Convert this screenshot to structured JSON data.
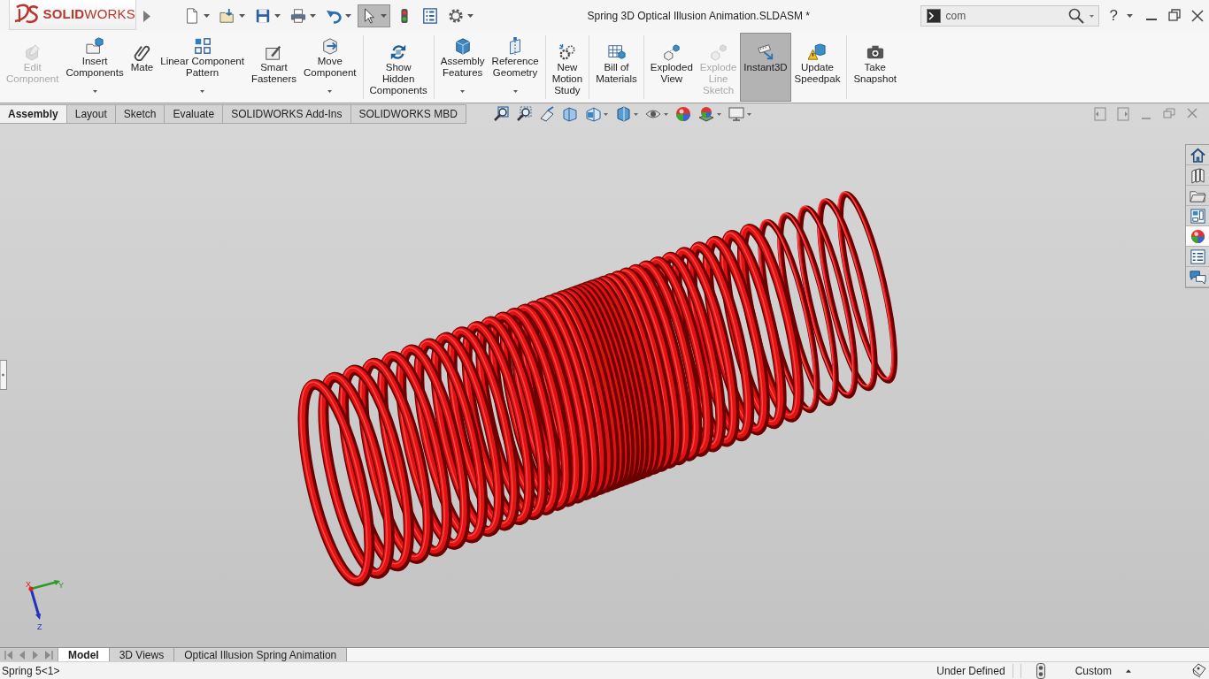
{
  "title_bar": {
    "logo": "**SOLID**WORKS",
    "quick_access": [
      {
        "selected": false,
        "dropdown": true
      },
      {
        "selected": false,
        "dropdown": true
      },
      {
        "selected": false,
        "dropdown": true
      },
      {
        "selected": false,
        "dropdown": true
      },
      {
        "selected": false,
        "dropdown": true
      },
      {
        "selected": true,
        "dropdown": true
      },
      {
        "selected": false,
        "dropdown": false
      },
      {
        "selected": false,
        "dropdown": false
      },
      {
        "selected": false,
        "dropdown": true
      }
    ],
    "document_title": "Spring 3D Optical Illusion Animation.SLDASM *",
    "search": {
      "value": "com"
    },
    "help": "?"
  },
  "command_manager": {
    "groups": [
      [
        {
          "label": "Edit\nComponent",
          "disabled": true,
          "selected": false,
          "dropdown": false
        },
        {
          "label": "Insert\nComponents",
          "disabled": false,
          "selected": false,
          "dropdown": true
        },
        {
          "label": "Mate",
          "disabled": false,
          "selected": false,
          "dropdown": false
        },
        {
          "label": "Linear Component\nPattern",
          "disabled": false,
          "selected": false,
          "dropdown": true
        },
        {
          "label": "Smart\nFasteners",
          "disabled": false,
          "selected": false,
          "dropdown": false
        },
        {
          "label": "Move\nComponent",
          "disabled": false,
          "selected": false,
          "dropdown": true
        }
      ],
      [
        {
          "label": "Show\nHidden\nComponents",
          "disabled": false,
          "selected": false,
          "dropdown": false
        }
      ],
      [
        {
          "label": "Assembly\nFeatures",
          "disabled": false,
          "selected": false,
          "dropdown": true
        },
        {
          "label": "Reference\nGeometry",
          "disabled": false,
          "selected": false,
          "dropdown": true
        }
      ],
      [
        {
          "label": "New\nMotion\nStudy",
          "disabled": false,
          "selected": false,
          "dropdown": false
        }
      ],
      [
        {
          "label": "Bill of\nMaterials",
          "disabled": false,
          "selected": false,
          "dropdown": false
        }
      ],
      [
        {
          "label": "Exploded\nView",
          "disabled": false,
          "selected": false,
          "dropdown": false
        },
        {
          "label": "Explode\nLine\nSketch",
          "disabled": true,
          "selected": false,
          "dropdown": false
        },
        {
          "label": "Instant3D",
          "disabled": false,
          "selected": true,
          "dropdown": false
        },
        {
          "label": "Update\nSpeedpak",
          "disabled": false,
          "selected": false,
          "dropdown": false
        }
      ],
      [
        {
          "label": "Take\nSnapshot",
          "disabled": false,
          "selected": false,
          "dropdown": false
        }
      ]
    ]
  },
  "command_tabs": [
    {
      "label": "Assembly",
      "selected": true
    },
    {
      "label": "Layout",
      "selected": false
    },
    {
      "label": "Sketch",
      "selected": false
    },
    {
      "label": "Evaluate",
      "selected": false
    },
    {
      "label": "SOLIDWORKS Add-Ins",
      "selected": false
    },
    {
      "label": "SOLIDWORKS MBD",
      "selected": false
    }
  ],
  "view_toolbar": [
    {
      "dropdown": false
    },
    {
      "dropdown": false
    },
    {
      "dropdown": false
    },
    {
      "dropdown": false
    },
    {
      "dropdown": true
    },
    {
      "dropdown": true
    },
    {
      "dropdown": true
    },
    {
      "dropdown": false
    },
    {
      "dropdown": true
    },
    {
      "dropdown": true
    }
  ],
  "task_pane": [
    {
      "selected": false
    },
    {
      "selected": false
    },
    {
      "selected": false
    },
    {
      "selected": false
    },
    {
      "selected": true
    },
    {
      "selected": false
    },
    {
      "selected": false
    }
  ],
  "triad": [
    "X",
    "Y",
    "Z"
  ],
  "sheet_tabs": [
    {
      "label": "Model",
      "selected": true
    },
    {
      "label": "3D Views",
      "selected": false
    },
    {
      "label": "Optical Illusion Spring Animation",
      "selected": false
    }
  ],
  "status_bar": {
    "selection": "Spring 5<1>",
    "state": "Under Defined",
    "units": "Custom"
  }
}
